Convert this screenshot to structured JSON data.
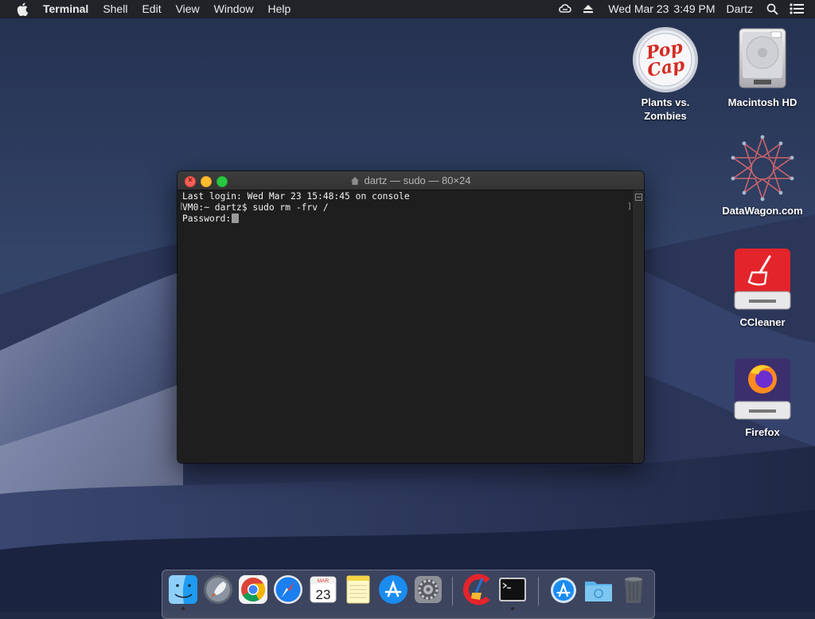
{
  "menubar": {
    "app_name": "Terminal",
    "items": [
      "Shell",
      "Edit",
      "View",
      "Window",
      "Help"
    ],
    "date": "Wed Mar 23",
    "time": "3:49 PM",
    "user": "Dartz",
    "status_icons": [
      "creative-cloud-icon",
      "eject-icon",
      "spotlight-icon",
      "notification-center-icon"
    ]
  },
  "desktop_icons": [
    {
      "label": "Plants vs. Zombies",
      "icon": "popcap-icon"
    },
    {
      "label": "Macintosh HD",
      "icon": "hard-drive-icon"
    },
    {
      "label": "DataWagon.com",
      "icon": "datawagon-icon"
    },
    {
      "label": "CCleaner",
      "icon": "ccleaner-drive-icon"
    },
    {
      "label": "Firefox",
      "icon": "firefox-drive-icon"
    }
  ],
  "terminal": {
    "title": "dartz — sudo — 80×24",
    "lines": [
      "Last login: Wed Mar 23 15:48:45 on console",
      "VM0:~ dartz$ sudo rm -frv /",
      "Password:"
    ]
  },
  "dock": {
    "items": [
      {
        "name": "Finder",
        "icon": "finder-icon",
        "running": true
      },
      {
        "name": "Launchpad",
        "icon": "launchpad-icon",
        "running": false
      },
      {
        "name": "Google Chrome",
        "icon": "chrome-icon",
        "running": false
      },
      {
        "name": "Safari",
        "icon": "safari-icon",
        "running": false
      },
      {
        "name": "Calendar",
        "icon": "calendar-icon",
        "running": false,
        "badge_month": "MAR",
        "badge_day": "23"
      },
      {
        "name": "Notes",
        "icon": "notes-icon",
        "running": false
      },
      {
        "name": "App Store",
        "icon": "app-store-icon",
        "running": false
      },
      {
        "name": "System Preferences",
        "icon": "system-preferences-icon",
        "running": false
      },
      {
        "name": "CCleaner",
        "icon": "ccleaner-icon",
        "running": false
      },
      {
        "name": "Terminal",
        "icon": "terminal-icon",
        "running": true
      },
      {
        "name": "Applications",
        "icon": "applications-folder-icon",
        "running": false
      },
      {
        "name": "Downloads",
        "icon": "downloads-folder-icon",
        "running": false
      },
      {
        "name": "Trash",
        "icon": "trash-icon",
        "running": false
      }
    ]
  },
  "colors": {
    "menubar_bg": "#222328",
    "terminal_bg": "#1e1e1e",
    "close": "#fe5f57",
    "minimize": "#febc2e",
    "zoom": "#28c840"
  }
}
